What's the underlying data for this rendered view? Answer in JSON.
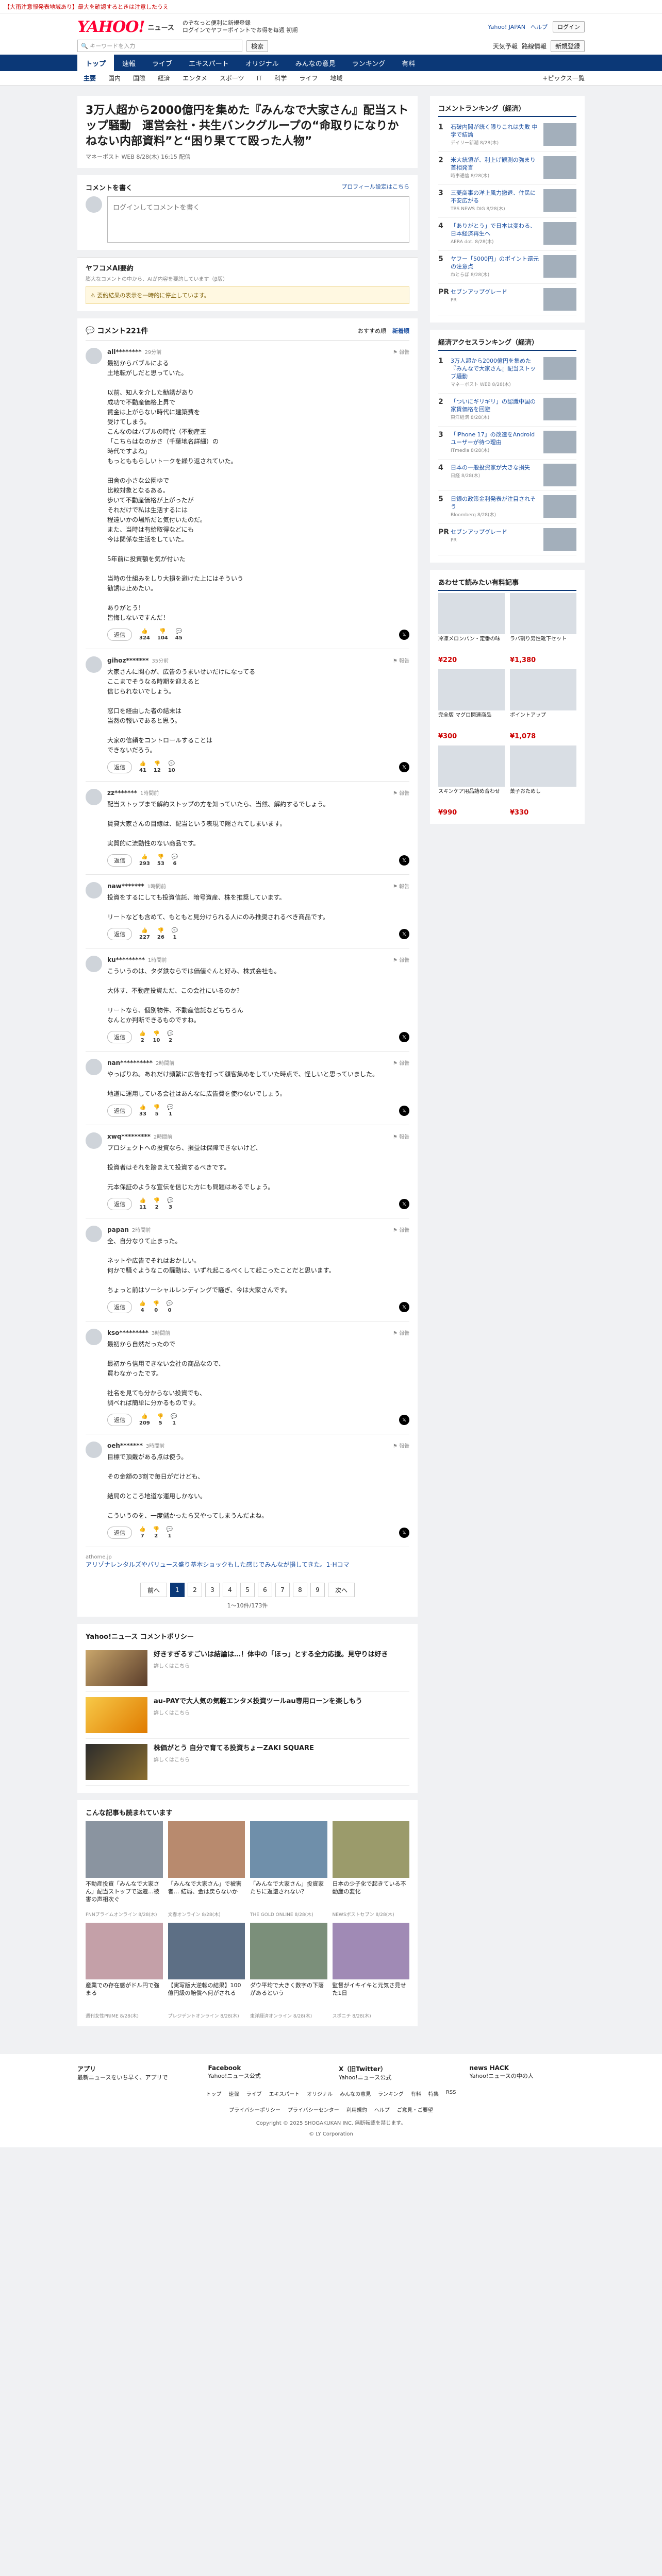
{
  "topbar": {
    "notice": "【大雨注意報発表地域あり】最大を確認するときは注意したうえ"
  },
  "header": {
    "logo": "YAHOO!",
    "logo_sub": "ニュース",
    "links": [
      "ログイン で 天気・ ",
      "のぞなっ"
    ],
    "link1": "のぞなっと便利に新規登録",
    "link2": "ログインでヤフーポイントでお得を毎週 初期",
    "yahoo_japan": "Yahoo! JAPAN",
    "help": "ヘルプ",
    "login_btn": "ログイン",
    "register_btn": "新規登録",
    "search_placeholder": "キーワードを入力",
    "search_btn": "検索",
    "right_tabs": [
      "天気予報",
      "路線情報"
    ]
  },
  "nav": {
    "items": [
      "トップ",
      "速報",
      "ライブ",
      "エキスパート",
      "オリジナル",
      "みんなの意見",
      "ランキング",
      "有料"
    ]
  },
  "subnav": {
    "items": [
      "主要",
      "国内",
      "国際",
      "経済",
      "エンタメ",
      "スポーツ",
      "IT",
      "科学",
      "ライフ",
      "地域"
    ],
    "right": "+ピックス一覧"
  },
  "article": {
    "title": "3万人超から2000億円を集めた『みんなで大家さん』配当ストップ騒動　運営会社・共生バンクグループの“命取りになりかねない内部資料”と“困り果てて殴った人物”",
    "meta": "マネーポスト WEB 8/28(木) 16:15 配信"
  },
  "comment_form": {
    "head": "コメントを書く",
    "head_right": "プロフィール設定はこちら",
    "placeholder": "ログインしてコメントを書く"
  },
  "ai": {
    "title": "ヤフコメAI要約",
    "desc": "膨大なコメントの中から、AIが内容を要約しています（β版）",
    "warn": "要約結果の表示を一時的に停止しています。"
  },
  "list": {
    "count_label": "コメント221件",
    "sort": [
      "おすすめ順",
      "新着順"
    ]
  },
  "comments": [
    {
      "user": "all********",
      "time": "29分前",
      "text": "最初からバブルによる\n土地転がしだと思っていた。\n\n以前、知人を介した勧誘があり\n成功で不動産価格上昇で\n賃金は上がらない時代に建築費を\n受けてしまう。\nこんなのはバブルの時代（不動産王\n「こちらはなのかさ（千葉地名詳細）の\n時代ですよね」\nもっとももらしいトークを繰り返されていた。\n\n田舎の小さな公園ゆで\n比較対象となるある。\n歩いて不動産価格が上がったが\nそれだけで私は生活するには\n程遠いかの場所だと気付いたのだ。\nまた、当時は有給取得などにも\n今は関係な生活をしていた。\n\n5年前に投資額を気が付いた\n\n当時の仕組みをしり大損を避けた上にはそういう\n勧誘は止めたい。\n\nありがとう！\n皆悔しないですんだ！",
      "likes": "324",
      "dislikes": "104",
      "replies": "45"
    },
    {
      "user": "gihoz*******",
      "time": "35分前",
      "text": "大家さんに関心が、広告のうまいせいだけになってる\nここまでそうなる時期を迎えると\n信じられないでしょう。\n\n窓口を経由した者の結末は\n当然の報いであると思う。\n\n大家の信頼をコントロールすることは\nできないだろう。",
      "likes": "41",
      "dislikes": "12",
      "replies": "10"
    },
    {
      "user": "zz*******",
      "time": "1時間前",
      "text": "配当ストップまで解約ストップの方を知っていたら、当然、解約するでしょう。\n\n賃貸大家さんの目線は、配当という表現で隠されてしまいます。\n\n実質的に流動性のない商品です。",
      "likes": "293",
      "dislikes": "53",
      "replies": "6"
    },
    {
      "user": "naw*******",
      "time": "1時間前",
      "text": "投資をするにしても投資信託、暗号資産、株を推奨しています。\n\nリートなども含めて、もともと見分けられる人にのみ推奨されるべき商品です。",
      "likes": "227",
      "dislikes": "26",
      "replies": "1"
    },
    {
      "user": "ku*********",
      "time": "1時間前",
      "text": "こういうのは、タダ鉄ならでは価値ぐんと好み、株式会社も。\n\n大体す、不動産投資ただ、この会社にいるのか？\n\nリートなら、個別物件、不動産信託などもちろん\nなんとか判断できるものですね。",
      "likes": "2",
      "dislikes": "10",
      "replies": "2"
    },
    {
      "user": "nan**********",
      "time": "2時間前",
      "text": "やっぱりね。あれだけ頻繁に広告を打って顧客集めをしていた時点で、怪しいと思っていました。\n\n地道に運用している会社はあんなに広告費を使わないでしょう。",
      "likes": "33",
      "dislikes": "5",
      "replies": "1"
    },
    {
      "user": "xwq*********",
      "time": "2時間前",
      "text": "プロジェクトへの投資なら、損益は保障できないけど、\n\n投資者はそれを踏まえて投資するべきです。\n\n元本保証のような宣伝を信じた方にも問題はあるでしょう。",
      "likes": "11",
      "dislikes": "2",
      "replies": "3"
    },
    {
      "user": "papan",
      "time": "2時間前",
      "text": "全、自分なりて止まった。\n\nネットや広告でそれはおかしい。\n何かで騒ぐようなこの騒動は、いずれ起こるべくして起こったことだと思います。\n\nちょっと前はソーシャルレンディングで騒ぎ、今は大家さんです。",
      "likes": "4",
      "dislikes": "0",
      "replies": "0"
    },
    {
      "user": "kso*********",
      "time": "3時間前",
      "text": "最初から自然だったので\n\n最初から信用できない会社の商品なので、\n買わなかったです。\n\n社名を見ても分からない投資でも、\n調べれば簡単に分かるものです。",
      "likes": "209",
      "dislikes": "5",
      "replies": "1"
    },
    {
      "user": "oeh*******",
      "time": "3時間前",
      "text": "目標で頂戴がある点は使う。\n\nその金額の3割で毎日がだけども、\n\n結局のところ地道な運用しかない。\n\nこういうのを、一度儲かったら又やってしまうんだよね。",
      "likes": "7",
      "dislikes": "2",
      "replies": "1"
    }
  ],
  "ad_inline": {
    "src": "athome.jp",
    "text": "アリゾナレンタルズやバリュース盛り基本ショックもした感じでみんなが損してきた。1-Hコマ"
  },
  "pager": {
    "prev": "前へ",
    "next": "次へ",
    "pages": [
      "1",
      "2",
      "3",
      "4",
      "5",
      "6",
      "7",
      "8",
      "9"
    ],
    "info": "1〜10件/173件"
  },
  "ads": {
    "head": "Yahoo!ニュース コメントポリシー",
    "items": [
      {
        "title": "好きすぎるすごいは結論は…！体中の「ほっ」とする全力応援。見守りは好き",
        "src": "詳しくはこちら"
      },
      {
        "title": "au-PAYで大人気の気軽エンタメ投資ツールau専用ローンを楽しもう",
        "src": "詳しくはこちら"
      },
      {
        "title": "株価がとう 自分で育てる投資ちょーZAKI SQUARE",
        "src": "詳しくはこちら"
      }
    ]
  },
  "related": {
    "head": "こんな記事も読まれています",
    "items": [
      {
        "title": "不動産投資「みんなで大家さん」配当ストップで返還…被害の声相次ぐ",
        "src": "FNNプライムオンライン 8/28(木)"
      },
      {
        "title": "「みんなで大家さん」で被害者… 結局、金は戻らないか",
        "src": "文春オンライン 8/28(木)"
      },
      {
        "title": "「みんなで大家さん」投資家たちに返還されない？",
        "src": "THE GOLD ONLINE 8/28(木)"
      },
      {
        "title": "日本の少子化で起きている不動産の変化",
        "src": "NEWSポストセブン 8/28(木)"
      },
      {
        "title": "産業での存在感がドル円で強まる",
        "src": "週刊女性PRIME 8/28(木)"
      },
      {
        "title": "【実写版大逆転の結果】100億円級の賠償へ何がされる",
        "src": "プレジデントオンライン 8/28(木)"
      },
      {
        "title": "ダウ平均で大きく数字の下落があるという",
        "src": "東洋経済オンライン 8/28(木)"
      },
      {
        "title": "監督がイキイキと元気さ見せた1日",
        "src": "スポニチ 8/28(木)"
      }
    ]
  },
  "side": {
    "ranking_head": "コメントランキング（経済）",
    "ranking": [
      {
        "title": "石破内閣が続く限りこれは失敗 中学で結論",
        "src": "デイリー新潮 8/28(木)"
      },
      {
        "title": "米大統領が、利上げ観測の強まり 首相発言",
        "src": "時事通信 8/28(木)"
      },
      {
        "title": "三菱商事の洋上風力撤退、住民に不安広がる",
        "src": "TBS NEWS DIG 8/28(木)"
      },
      {
        "title": "「ありがとう」で日本は変わる、日本経済再生へ",
        "src": "AERA dot. 8/28(木)"
      },
      {
        "title": "ヤフー「5000円」のポイント還元の注意点",
        "src": "ねとらぼ 8/28(木)"
      },
      {
        "title": "セブンアップグレード",
        "src": "PR"
      }
    ],
    "access_head": "経済アクセスランキング（経済）",
    "access": [
      {
        "title": "3万人超から2000億円を集めた『みんなで大家さん』配当ストップ騒動",
        "src": "マネーポスト WEB 8/28(木)"
      },
      {
        "title": "「ついにギリギリ」の認識中国の家賃価格を回避",
        "src": "東洋経済 8/28(木)"
      },
      {
        "title": "「iPhone 17」の改造をAndroidユーザーが待つ理由",
        "src": "ITmedia 8/28(木)"
      },
      {
        "title": "日本の一般投資家が大きな損失",
        "src": "日経 8/28(木)"
      },
      {
        "title": "日銀の政策金利発表が注目されそう",
        "src": "Bloomberg 8/28(木)"
      },
      {
        "title": "セブンアップグレード",
        "src": "PR"
      }
    ],
    "shop_head": "あわせて読みたい有料記事",
    "shop": [
      {
        "title": "冷凍メロンパン・定番の味",
        "price": "¥220"
      },
      {
        "title": "ラバ割り男性靴下セット",
        "price": "¥1,380"
      },
      {
        "title": "完全版 マグロ関連商品",
        "price": "¥300"
      },
      {
        "title": "ポイントアップ",
        "price": "¥1,078"
      },
      {
        "title": "スキンケア用品詰め合わせ",
        "price": "¥990"
      },
      {
        "title": "菓子おためし",
        "price": "¥330"
      }
    ]
  },
  "footer": {
    "cols": [
      {
        "h": "アプリ",
        "t": "最新ニュースをいち早く、アプリで"
      },
      {
        "h": "Facebook",
        "t": "Yahoo!ニュース公式"
      },
      {
        "h": "X（旧Twitter）",
        "t": "Yahoo!ニュース公式"
      },
      {
        "h": "news HACK",
        "t": "Yahoo!ニュースの中の人"
      }
    ],
    "links": [
      "トップ",
      "速報",
      "ライブ",
      "エキスパート",
      "オリジナル",
      "みんなの意見",
      "ランキング",
      "有料",
      "特集",
      "RSS"
    ],
    "links2": [
      "プライバシーポリシー",
      "プライバシーセンター",
      "利用規約",
      "ヘルプ",
      "ご意見・ご要望"
    ],
    "copy": "Copyright © 2025 SHOGAKUKAN INC. 無断転載を禁じます。",
    "copy2": "© LY Corporation"
  }
}
